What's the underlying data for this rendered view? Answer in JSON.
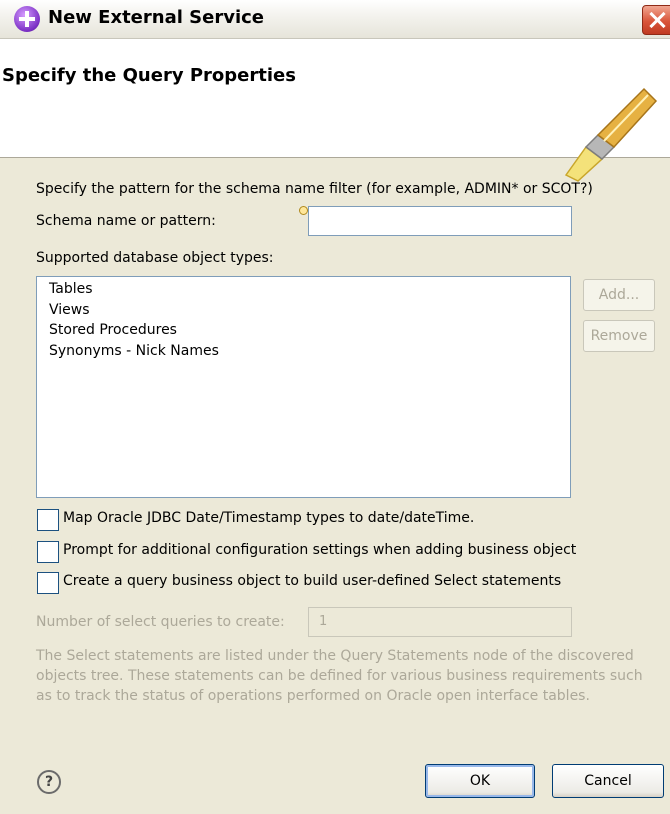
{
  "window": {
    "title": "New External Service"
  },
  "banner": {
    "title": "Specify the Query Properties"
  },
  "form": {
    "instruction": "Specify the pattern for the schema name filter (for example, ADMIN* or SCOT?)",
    "schema_label": "Schema name or pattern:",
    "schema_value": "",
    "types_label": "Supported database object types:",
    "object_types": [
      "Tables",
      "Views",
      "Stored Procedures",
      "Synonyms - Nick Names"
    ],
    "add_label": "Add...",
    "remove_label": "Remove",
    "checkboxes": [
      {
        "label": "Map Oracle JDBC Date/Timestamp types to date/dateTime.",
        "checked": false
      },
      {
        "label": "Prompt for additional configuration settings when adding business object",
        "checked": false
      },
      {
        "label": "Create a query business object to build user-defined Select statements",
        "checked": false
      }
    ],
    "queries_label": "Number of select queries to create:",
    "queries_value": "1",
    "description": "The Select statements are listed under the Query Statements node of the discovered objects tree. These statements can be defined for various business requirements such as to track the status of operations performed on Oracle open interface tables."
  },
  "footer": {
    "help_glyph": "?",
    "ok_label": "OK",
    "cancel_label": "Cancel"
  },
  "colors": {
    "accent": "#7a2fc4",
    "close": "#d9553a",
    "disabled_text": "#aca899",
    "border": "#7f9db9"
  }
}
